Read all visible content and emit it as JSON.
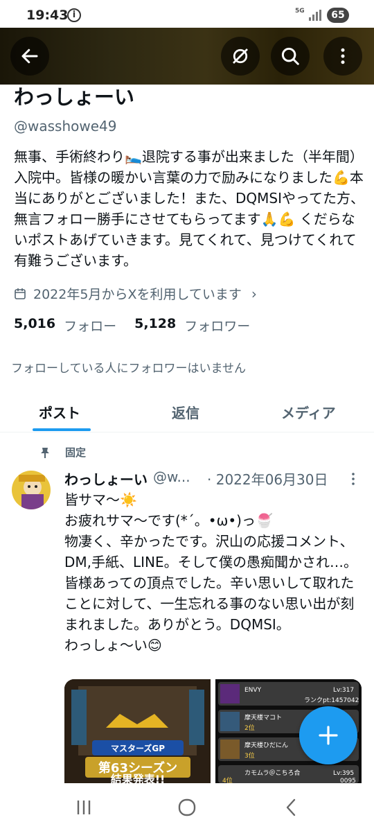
{
  "status": {
    "time": "19:43",
    "network": "5G",
    "battery": "65"
  },
  "profile": {
    "name": "わっしょーい",
    "handle": "@wasshowe49",
    "bio": "無事、手術終わり🛌退院する事が出来ました（半年間）入院中。皆様の暖かい言葉の力で励みになりました💪本当にありがとございました！また、DQMSIやってた方、無言フォロー勝手にさせてもらってます🙏💪 くだらないポストあげていきます。見てくれて、見つけてくれて有難うございます。",
    "joined": "2022年5月からXを利用しています",
    "following_count": "5,016",
    "following_label": "フォロー",
    "followers_count": "5,128",
    "followers_label": "フォロワー",
    "no_mutual": "フォローしている人にフォロワーはいません"
  },
  "tabs": [
    "ポスト",
    "返信",
    "メディア"
  ],
  "pinned_label": "固定",
  "tweet": {
    "name": "わっしょーい",
    "handle": "@w...",
    "date": "· 2022年06月30日",
    "body": "皆サマ〜☀️\nお疲れサマ〜です(*´。•ω•)っ🍧\n物凄く、辛かったです。沢山の応援コメント、DM,手紙、LINE。そして僕の愚痴聞かされ…。皆様あっての頂点でした。辛い思いして取れたことに対して、一生忘れる事のない思い出が刻まれました。ありがとう。DQMSI。\nわっしょ〜い😊"
  },
  "media1": {
    "banner1": "マスターズGP",
    "banner2": "第63シーズン",
    "banner3": "結果発表!!"
  },
  "media2": {
    "rows": [
      {
        "name": "ENVY",
        "rank": "",
        "lv": "Lv:317",
        "pt": "ランクpt:1457042"
      },
      {
        "name": "摩天楼マコト",
        "rank": "2位",
        "lv": "",
        "pt": ""
      },
      {
        "name": "摩天楼ひだにん",
        "rank": "3位",
        "lv": "",
        "pt": ""
      },
      {
        "name": "カモムラ＠こちろ合",
        "rank": "4位",
        "lv": "Lv:395",
        "pt": "0095"
      }
    ]
  },
  "colors": {
    "accent": "#1d9bf0",
    "text": "#0f1419",
    "secondary": "#536471"
  }
}
